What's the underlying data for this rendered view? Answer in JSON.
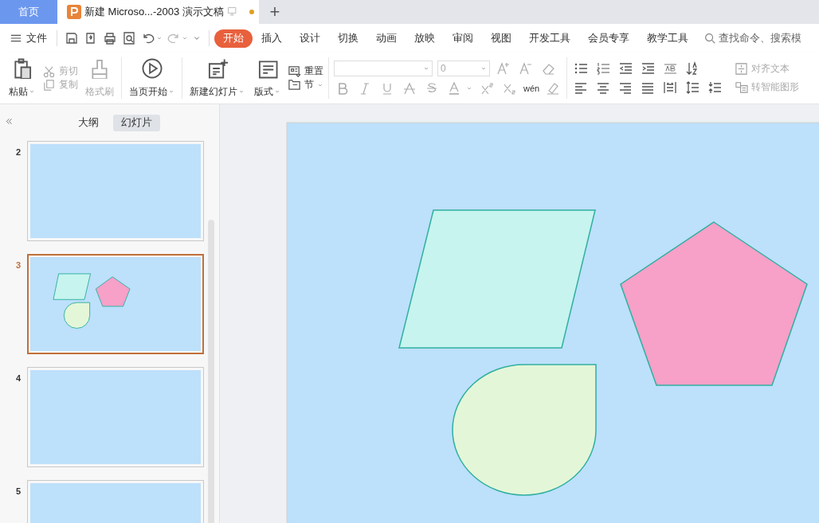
{
  "title_bar": {
    "home_tab": {
      "label": "首页",
      "selected": false
    },
    "doc_tab": {
      "title": "新建 Microso...-2003 演示文稿",
      "selected": true,
      "unsaved": true
    },
    "new_tab": "+"
  },
  "menu_bar": {
    "file_label": "文件",
    "tabs": [
      {
        "label": "开始",
        "selected": true
      },
      {
        "label": "插入",
        "selected": false
      },
      {
        "label": "设计",
        "selected": false
      },
      {
        "label": "切换",
        "selected": false
      },
      {
        "label": "动画",
        "selected": false
      },
      {
        "label": "放映",
        "selected": false
      },
      {
        "label": "审阅",
        "selected": false
      },
      {
        "label": "视图",
        "selected": false
      },
      {
        "label": "开发工具",
        "selected": false
      },
      {
        "label": "会员专享",
        "selected": false
      },
      {
        "label": "教学工具",
        "selected": false
      }
    ],
    "search": {
      "placeholder": "查找命令、搜索模"
    }
  },
  "ribbon": {
    "clipboard": {
      "paste": {
        "label": "粘贴",
        "disabled": false
      },
      "cut": {
        "label": "剪切",
        "disabled": true
      },
      "copy": {
        "label": "复制",
        "disabled": true
      },
      "format_painter": {
        "label": "格式刷",
        "disabled": true
      }
    },
    "slideshow": {
      "label": "当页开始"
    },
    "slides": {
      "new_slide": {
        "label": "新建幻灯片"
      },
      "layout": {
        "label": "版式"
      },
      "reset": {
        "label": "重置"
      },
      "section": {
        "label": "节"
      }
    },
    "font": {
      "size_field": {
        "value": "0"
      },
      "phonetic": {
        "label": "wén"
      }
    },
    "paragraph": {
      "align_text": {
        "label": "对齐文本",
        "disabled": true
      },
      "smart_art": {
        "label": "转智能图形",
        "disabled": true
      }
    }
  },
  "panel": {
    "view_tabs": [
      {
        "label": "大纲",
        "selected": false
      },
      {
        "label": "幻灯片",
        "selected": true
      }
    ],
    "slides": [
      {
        "number": "2",
        "selected": false,
        "kind": "blank"
      },
      {
        "number": "3",
        "selected": true,
        "kind": "shapes"
      },
      {
        "number": "4",
        "selected": false,
        "kind": "blank"
      },
      {
        "number": "5",
        "selected": false,
        "kind": "blank"
      }
    ]
  },
  "canvas": {
    "slide": {
      "kind": "shapes"
    }
  }
}
